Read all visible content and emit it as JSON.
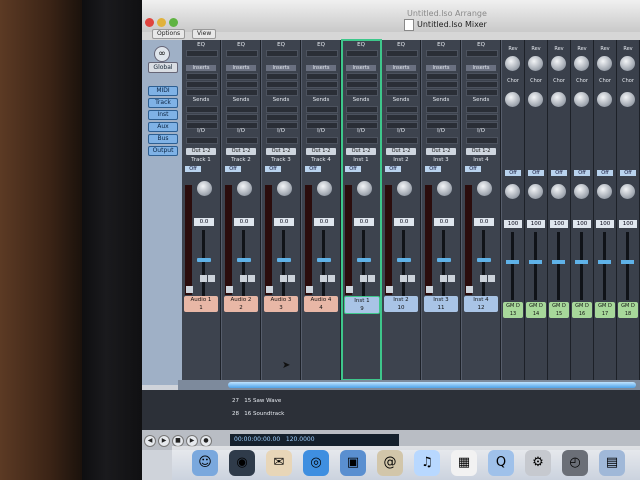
{
  "window": {
    "back_title": "Untitled.lso Arrange",
    "front_title": "Untitled.lso Mixer"
  },
  "toolbar": {
    "options_label": "Options",
    "view_label": "View"
  },
  "left_panel": {
    "global_label": "Global",
    "filters": [
      "MIDI",
      "Track",
      "Inst",
      "Aux",
      "Bus",
      "Output"
    ]
  },
  "strip_labels": {
    "eq": "EQ",
    "inserts": "Inserts",
    "sends": "Sends",
    "io": "I/O",
    "off": "Off"
  },
  "channels": [
    {
      "output": "Out 1-2",
      "track": "Track 1",
      "value": "0.0",
      "name": "Audio 1",
      "num": "1",
      "type": "audio"
    },
    {
      "output": "Out 1-2",
      "track": "Track 2",
      "value": "0.0",
      "name": "Audio 2",
      "num": "2",
      "type": "audio"
    },
    {
      "output": "Out 1-2",
      "track": "Track 3",
      "value": "0.0",
      "name": "Audio 3",
      "num": "3",
      "type": "audio"
    },
    {
      "output": "Out 1-2",
      "track": "Track 4",
      "value": "0.0",
      "name": "Audio 4",
      "num": "4",
      "type": "audio"
    },
    {
      "output": "Out 1-2",
      "track": "Inst 1",
      "value": "0.0",
      "name": "Inst 1",
      "num": "9",
      "type": "inst"
    },
    {
      "output": "Out 1-2",
      "track": "Inst 2",
      "value": "0.0",
      "name": "Inst 2",
      "num": "10",
      "type": "inst"
    },
    {
      "output": "Out 1-2",
      "track": "Inst 3",
      "value": "0.0",
      "name": "Inst 3",
      "num": "11",
      "type": "inst"
    },
    {
      "output": "Out 1-2",
      "track": "Inst 4",
      "value": "0.0",
      "name": "Inst 4",
      "num": "12",
      "type": "inst"
    }
  ],
  "bus_strips": [
    {
      "rev": "Rev",
      "chor": "Chor",
      "off": "Off",
      "value": "100",
      "name": "GM D",
      "num": "13"
    },
    {
      "rev": "Rev",
      "chor": "Chor",
      "off": "Off",
      "value": "100",
      "name": "GM D",
      "num": "14"
    },
    {
      "rev": "Rev",
      "chor": "Chor",
      "off": "Off",
      "value": "100",
      "name": "GM D",
      "num": "15"
    },
    {
      "rev": "Rev",
      "chor": "Chor",
      "off": "Off",
      "value": "100",
      "name": "GM D",
      "num": "16"
    },
    {
      "rev": "Rev",
      "chor": "Chor",
      "off": "Off",
      "value": "100",
      "name": "GM D",
      "num": "17"
    },
    {
      "rev": "Rev",
      "chor": "Chor",
      "off": "Off",
      "value": "100",
      "name": "GM D",
      "num": "18"
    }
  ],
  "arrange_rows": [
    {
      "num": "27",
      "idx": "15",
      "name": "Saw Wave"
    },
    {
      "num": "28",
      "idx": "16",
      "name": "Soundtrack"
    }
  ],
  "transport": {
    "position": "00:00:00:00.00",
    "tempo": "120.0000"
  },
  "dock_icons": [
    "finder-icon",
    "dashboard-icon",
    "mail-bird-icon",
    "safari-icon",
    "ichat-icon",
    "address-book-icon",
    "itunes-icon",
    "ical-icon",
    "quicktime-icon",
    "system-preferences-icon",
    "activity-icon",
    "appstore-icon"
  ],
  "colors": {
    "audio_name_bg": "#e8b7a6",
    "inst_name_bg": "#a9c4e6",
    "bus_name_bg": "#a7d89a",
    "selected_outline": "#3ec78b",
    "fader_cap": "#5fb2e8"
  }
}
